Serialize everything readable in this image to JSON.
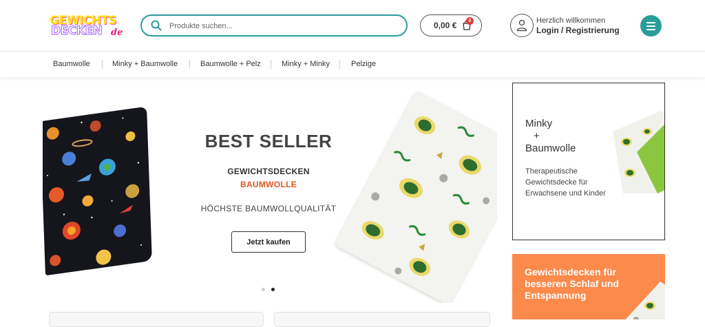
{
  "header": {
    "logo": {
      "line1": "GEWICHTS",
      "line2": "DECKEN",
      "suffix": "de"
    },
    "search": {
      "placeholder": "Produkte suchen..."
    },
    "cart": {
      "amount": "0,00 €",
      "count": "0"
    },
    "account": {
      "welcome": "Herzlich willkommen",
      "login": "Login / Registrierung"
    }
  },
  "categories": [
    {
      "label": "Baumwolle"
    },
    {
      "label": "Minky + Baumwolle"
    },
    {
      "label": "Baumwolle + Pelz"
    },
    {
      "label": "Minky + Minky"
    },
    {
      "label": "Pelzige"
    }
  ],
  "hero": {
    "title": "BEST SELLER",
    "subtitle": "GEWICHTSDECKEN",
    "highlight": "BAUMWOLLE",
    "tagline": "HÖCHSTE BAUMWOLLQUALITÄT",
    "cta": "Jetzt kaufen",
    "slides": 2,
    "active_slide": 2
  },
  "side_banner_1": {
    "title_line1": "Minky",
    "title_line2": "+",
    "title_line3": "Baumwolle",
    "text": "Therapeutische Gewichtsdecke für Erwachsene und Kinder"
  },
  "side_banner_2": {
    "text": "Gewichtsdecken für besseren Schlaf und Entspannung"
  },
  "colors": {
    "accent": "#2a9d9a",
    "highlight": "#e0541f",
    "banner_orange": "#fb8a4b",
    "badge": "#e53935"
  }
}
